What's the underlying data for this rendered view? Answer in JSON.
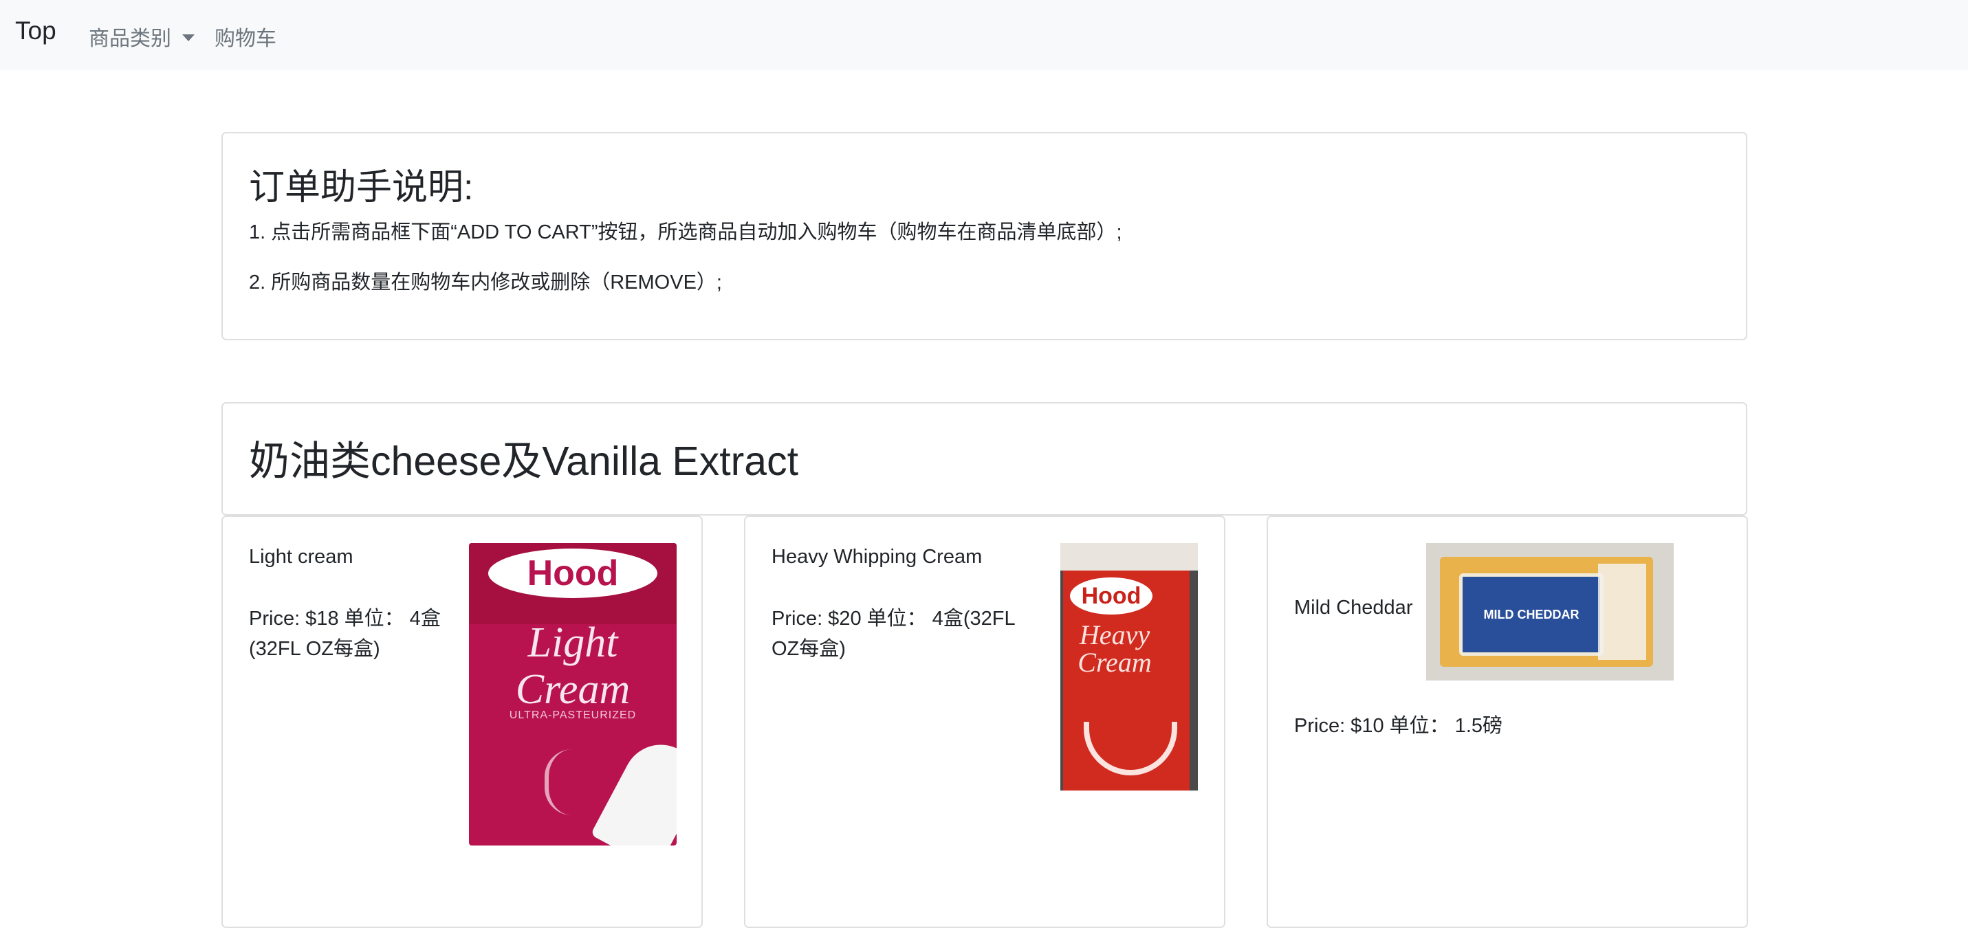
{
  "nav": {
    "brand": "Top",
    "categories_label": "商品类别",
    "cart_label": "购物车"
  },
  "instructions": {
    "title": "订单助手说明:",
    "line1": "1. 点击所需商品框下面“ADD TO CART”按钮，所选商品自动加入购物车（购物车在商品清单底部）;",
    "line2": "2. 所购商品数量在购物车内修改或删除（REMOVE）;"
  },
  "section": {
    "heading": "奶油类cheese及Vanilla Extract"
  },
  "products": [
    {
      "name": "Light cream",
      "info": "Price: $18 单位：  4盒(32FL OZ每盒)",
      "image": {
        "brand": "Hood",
        "line1": "Light",
        "line2": "Cream",
        "small": "ULTRA-PASTEURIZED"
      }
    },
    {
      "name": "Heavy Whipping Cream",
      "info": "Price: $20 单位：  4盒(32FL OZ每盒)",
      "image": {
        "brand": "Hood",
        "line1": "Heavy",
        "line2": "Cream"
      }
    },
    {
      "name": "Mild Cheddar",
      "info": "Price: $10 单位：  1.5磅",
      "image": {
        "label": "MILD CHEDDAR"
      }
    }
  ]
}
